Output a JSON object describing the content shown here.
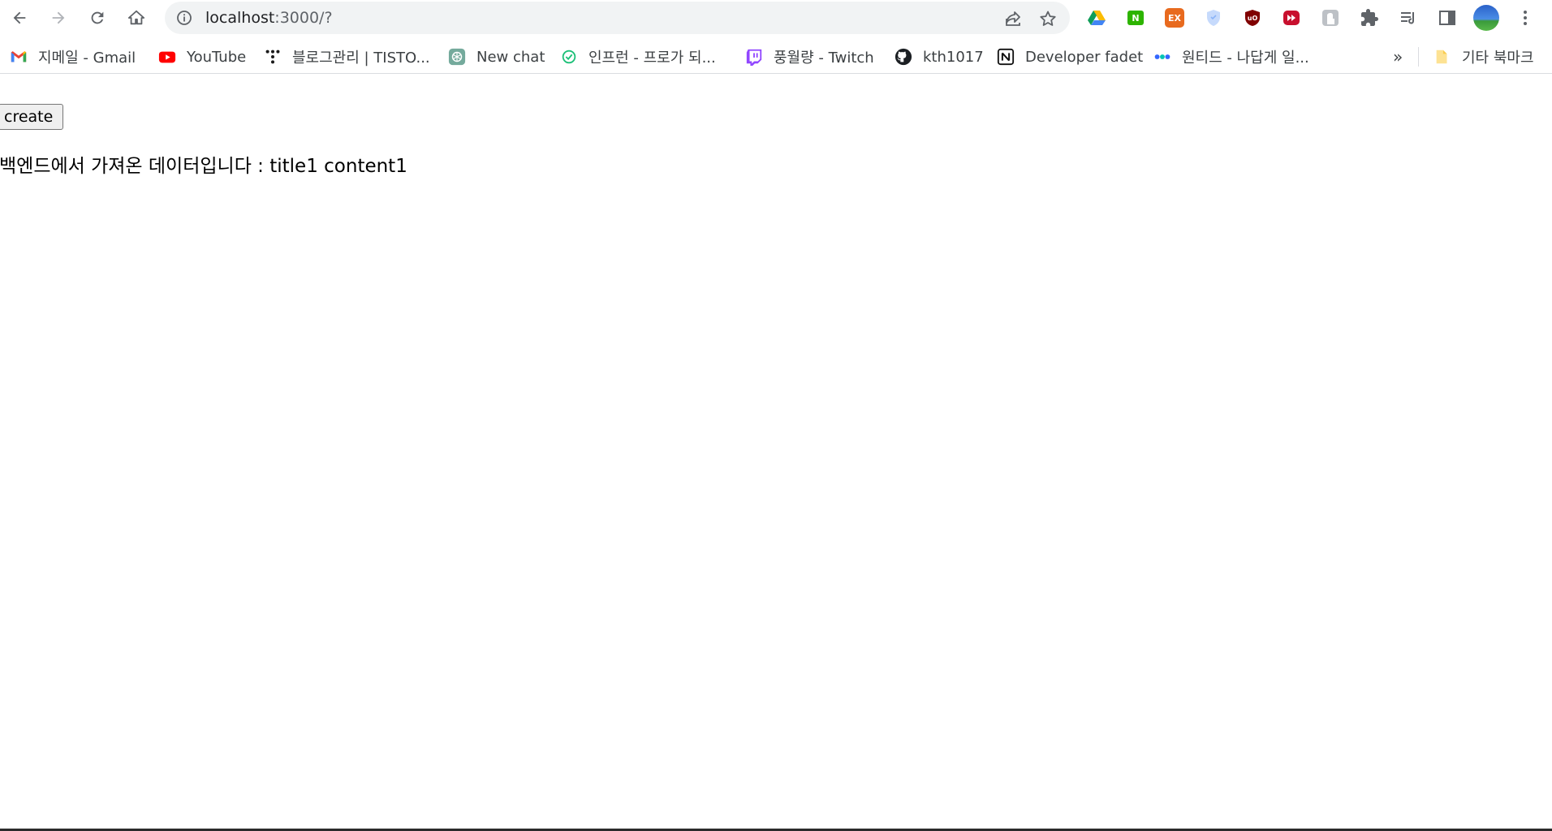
{
  "browser": {
    "address_bar": {
      "host": "localhost",
      "rest": ":3000/?"
    },
    "nav": {
      "back_icon": "arrow-left-icon",
      "forward_icon": "arrow-right-icon",
      "reload_icon": "reload-icon",
      "home_icon": "home-icon"
    },
    "extensions": [
      {
        "name": "google-drive-icon",
        "color": "#1a73e8"
      },
      {
        "name": "naver-extension-icon",
        "label": "N",
        "color": "#2db400"
      },
      {
        "name": "ex-extension-icon",
        "label": "EX",
        "color": "#e86a1e"
      },
      {
        "name": "shield-extension-icon",
        "color": "#a8c7fa"
      },
      {
        "name": "ublock-origin-icon",
        "label": "uO",
        "color": "#800000"
      },
      {
        "name": "fast-forward-extension-icon",
        "color": "#c8102e"
      },
      {
        "name": "grey-extension-icon",
        "color": "#9aa0a6"
      },
      {
        "name": "puzzle-extensions-icon",
        "color": "#5f6368"
      },
      {
        "name": "reading-list-icon",
        "color": "#5f6368"
      },
      {
        "name": "side-panel-icon",
        "color": "#5f6368"
      }
    ]
  },
  "bookmarks": [
    {
      "label": "지메일 - Gmail",
      "icon": "gmail-icon"
    },
    {
      "label": "YouTube",
      "icon": "youtube-icon"
    },
    {
      "label": "블로그관리 | TISTO...",
      "icon": "tistory-icon"
    },
    {
      "label": "New chat",
      "icon": "chatgpt-icon"
    },
    {
      "label": "인프런 - 프로가 되...",
      "icon": "inflearn-icon"
    },
    {
      "label": "풍월량 - Twitch",
      "icon": "twitch-icon"
    },
    {
      "label": "kth1017",
      "icon": "github-icon"
    },
    {
      "label": "Developer fadet",
      "icon": "notion-icon"
    },
    {
      "label": "원티드 - 나답게 일...",
      "icon": "wanted-icon"
    }
  ],
  "bookmarks_more": "»",
  "other_bookmarks": {
    "label": "기타 북마크",
    "icon": "folder-icon"
  },
  "page": {
    "create_button": "create",
    "message": "백엔드에서 가져온 데이터입니다 : title1 content1"
  }
}
